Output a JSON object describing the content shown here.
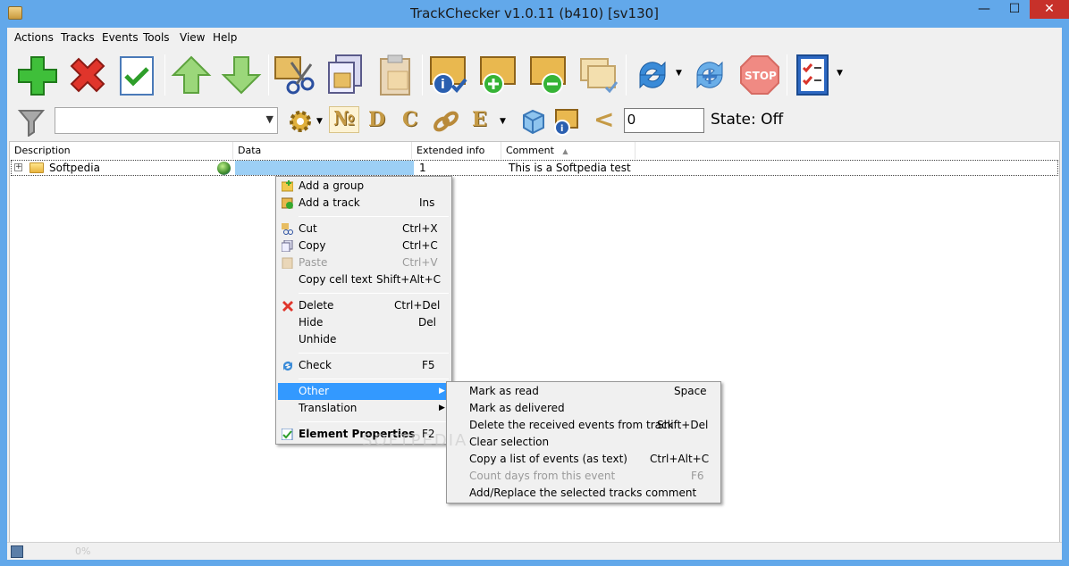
{
  "window": {
    "title": "TrackChecker v1.0.11 (b410)  [sv130]",
    "min": "—",
    "max": "☐",
    "close": "✕"
  },
  "menubar": [
    "Actions",
    "Tracks",
    "Events",
    "Tools",
    "View",
    "Help"
  ],
  "toolbar1": {
    "icons": [
      "add-icon",
      "delete-icon",
      "check-icon",
      "move-up-icon",
      "move-down-icon",
      "cut-icon",
      "copy-icon",
      "paste-icon",
      "track-info-icon",
      "add-track-icon",
      "remove-track-icon",
      "check-tracks-icon",
      "refresh-icon",
      "refresh-all-icon",
      "stop-icon",
      "checklist-icon"
    ],
    "stop_label": "STOP"
  },
  "toolbar2": {
    "filter_value": "",
    "letters": [
      "№",
      "D",
      "C",
      "E"
    ],
    "less_than": "<",
    "number_value": "0",
    "state": "State: Off"
  },
  "grid": {
    "headers": [
      "Description",
      "Data",
      "Extended info",
      "Comment"
    ],
    "sort_indicator": "▲",
    "row": {
      "expander": "+",
      "description": "Softpedia",
      "data": "",
      "extended": "1",
      "comment": "This is a Softpedia test"
    }
  },
  "context_menu": [
    {
      "label": "Add a group",
      "shortcut": ""
    },
    {
      "label": "Add a track",
      "shortcut": "Ins"
    },
    {
      "label": "Cut",
      "shortcut": "Ctrl+X"
    },
    {
      "label": "Copy",
      "shortcut": "Ctrl+C"
    },
    {
      "label": "Paste",
      "shortcut": "Ctrl+V"
    },
    {
      "label": "Copy cell text",
      "shortcut": "Shift+Alt+C"
    },
    {
      "label": "Delete",
      "shortcut": "Ctrl+Del"
    },
    {
      "label": "Hide",
      "shortcut": "Del"
    },
    {
      "label": "Unhide",
      "shortcut": ""
    },
    {
      "label": "Check",
      "shortcut": "F5"
    },
    {
      "label": "Other",
      "shortcut": ""
    },
    {
      "label": "Translation",
      "shortcut": ""
    },
    {
      "label": "Element Properties",
      "shortcut": "F2"
    }
  ],
  "submenu": [
    {
      "label": "Mark as read",
      "shortcut": "Space"
    },
    {
      "label": "Mark as delivered",
      "shortcut": ""
    },
    {
      "label": "Delete the received events from track",
      "shortcut": "Shift+Del"
    },
    {
      "label": "Clear selection",
      "shortcut": ""
    },
    {
      "label": "Copy a list of events (as text)",
      "shortcut": "Ctrl+Alt+C"
    },
    {
      "label": "Count days from this event",
      "shortcut": "F6"
    },
    {
      "label": "Add/Replace the selected tracks comment",
      "shortcut": ""
    }
  ],
  "statusbar": {
    "progress": "0%"
  },
  "watermark": "SOFTPEDIA",
  "colors": {
    "highlight": "#3399ff",
    "titlebar": "#62a8ea",
    "close": "#c7312a",
    "selected_cell": "#9ccff5"
  }
}
